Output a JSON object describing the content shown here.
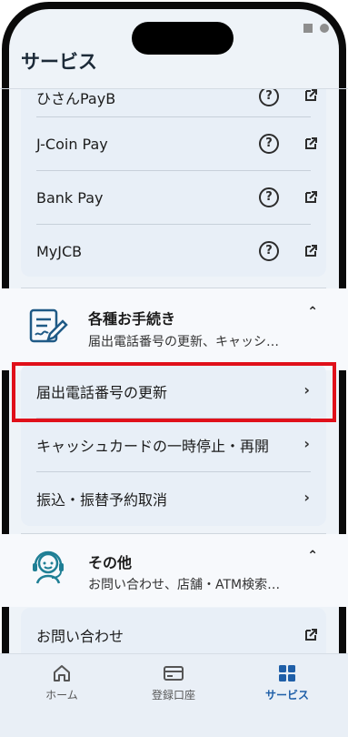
{
  "header": {
    "title": "サービス"
  },
  "payments": {
    "items": [
      {
        "label": "ひさんPayB"
      },
      {
        "label": "J-Coin Pay"
      },
      {
        "label": "Bank Pay"
      },
      {
        "label": "MyJCB"
      }
    ]
  },
  "procedures": {
    "title": "各種お手続き",
    "subtitle": "届出電話番号の更新、キャッシ…",
    "items": [
      {
        "label": "届出電話番号の更新"
      },
      {
        "label": "キャッシュカードの一時停止・再開"
      },
      {
        "label": "振込・振替予約取消"
      }
    ]
  },
  "other": {
    "title": "その他",
    "subtitle": "お問い合わせ、店舗・ATM検索…",
    "items": [
      {
        "label": "お問い合わせ"
      }
    ]
  },
  "nav": {
    "home": "ホーム",
    "accounts": "登録口座",
    "services": "サービス"
  },
  "colors": {
    "accent": "#1f5fa8",
    "highlight": "#e0101a"
  }
}
